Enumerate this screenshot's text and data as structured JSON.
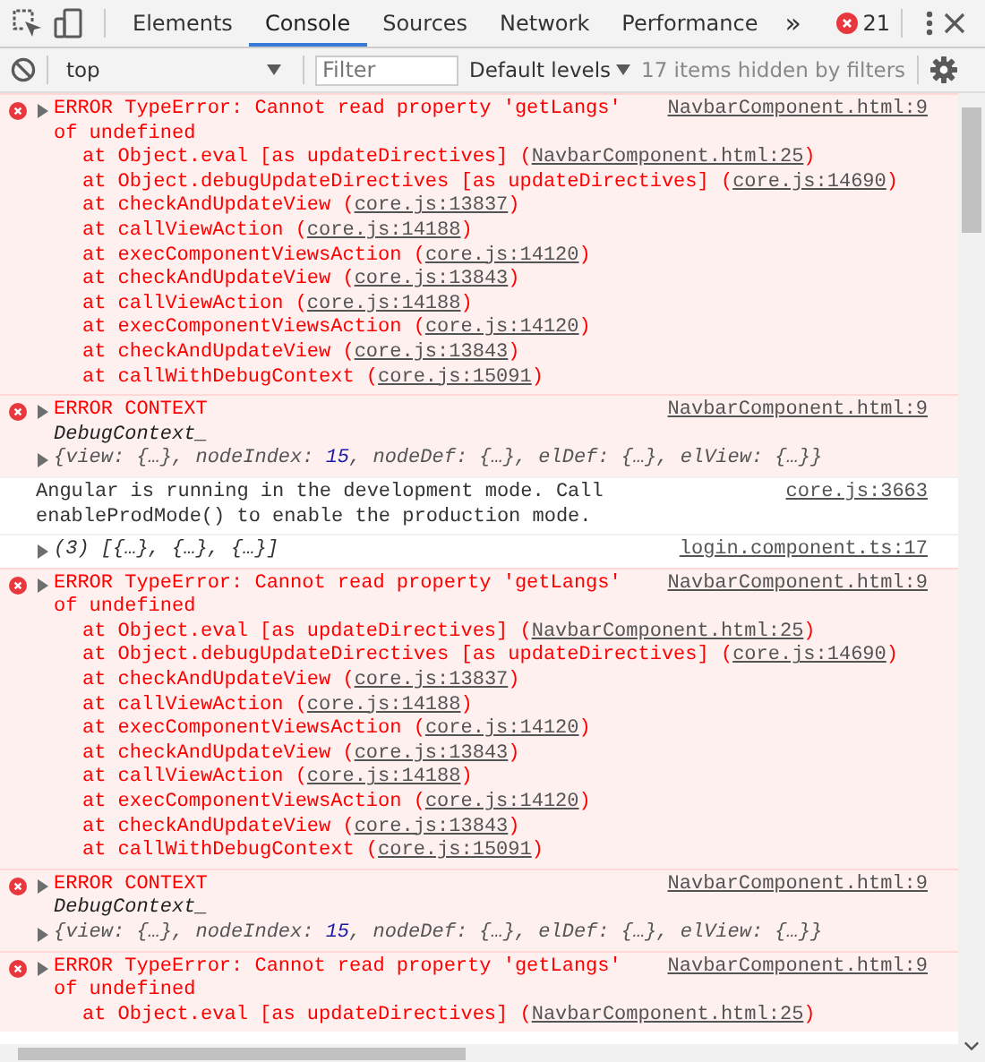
{
  "toolbar": {
    "tabs": [
      {
        "label": "Elements",
        "selected": false
      },
      {
        "label": "Console",
        "selected": true
      },
      {
        "label": "Sources",
        "selected": false
      },
      {
        "label": "Network",
        "selected": false
      },
      {
        "label": "Performance",
        "selected": false
      }
    ],
    "overflow": "»",
    "error_count": "21"
  },
  "console_bar": {
    "context": "top",
    "filter": {
      "placeholder": "Filter"
    },
    "levels": "Default levels",
    "hidden": "17 items hidden by filters"
  },
  "messages": [
    {
      "kind": "error",
      "expanded": false,
      "text": "ERROR TypeError: Cannot read property 'getLangs' of undefined",
      "source": "NavbarComponent.html:9",
      "stack": [
        {
          "call": "at Object.eval [as updateDirectives] (",
          "link": "NavbarComponent.html:25",
          "close": ")"
        },
        {
          "call": "at Object.debugUpdateDirectives [as updateDirectives] (",
          "link": "core.js:14690",
          "close": ")"
        },
        {
          "call": "at checkAndUpdateView (",
          "link": "core.js:13837",
          "close": ")"
        },
        {
          "call": "at callViewAction (",
          "link": "core.js:14188",
          "close": ")"
        },
        {
          "call": "at execComponentViewsAction (",
          "link": "core.js:14120",
          "close": ")"
        },
        {
          "call": "at checkAndUpdateView (",
          "link": "core.js:13843",
          "close": ")"
        },
        {
          "call": "at callViewAction (",
          "link": "core.js:14188",
          "close": ")"
        },
        {
          "call": "at execComponentViewsAction (",
          "link": "core.js:14120",
          "close": ")"
        },
        {
          "call": "at checkAndUpdateView (",
          "link": "core.js:13843",
          "close": ")"
        },
        {
          "call": "at callWithDebugContext (",
          "link": "core.js:15091",
          "close": ")"
        }
      ]
    },
    {
      "kind": "context",
      "expanded": false,
      "text": "ERROR CONTEXT",
      "source": "NavbarComponent.html:9",
      "object": {
        "name": "DebugContext_",
        "expanded": false,
        "preview": [
          {
            "kind": "plain",
            "text": "{view: {…}, nodeIndex: "
          },
          {
            "kind": "number",
            "text": "15"
          },
          {
            "kind": "plain",
            "text": ", nodeDef: {…}, elDef: {…}, elView: {…}}"
          }
        ]
      }
    },
    {
      "kind": "info",
      "text": "Angular is running in the development mode. Call enableProdMode() to enable the production mode.",
      "source": "core.js:3663"
    },
    {
      "kind": "log",
      "expanded": false,
      "text": "(3) [{…}, {…}, {…}]",
      "source": "login.component.ts:17"
    },
    {
      "kind": "error",
      "expanded": false,
      "text": "ERROR TypeError: Cannot read property 'getLangs' of undefined",
      "source": "NavbarComponent.html:9",
      "stack": [
        {
          "call": "at Object.eval [as updateDirectives] (",
          "link": "NavbarComponent.html:25",
          "close": ")"
        },
        {
          "call": "at Object.debugUpdateDirectives [as updateDirectives] (",
          "link": "core.js:14690",
          "close": ")"
        },
        {
          "call": "at checkAndUpdateView (",
          "link": "core.js:13837",
          "close": ")"
        },
        {
          "call": "at callViewAction (",
          "link": "core.js:14188",
          "close": ")"
        },
        {
          "call": "at execComponentViewsAction (",
          "link": "core.js:14120",
          "close": ")"
        },
        {
          "call": "at checkAndUpdateView (",
          "link": "core.js:13843",
          "close": ")"
        },
        {
          "call": "at callViewAction (",
          "link": "core.js:14188",
          "close": ")"
        },
        {
          "call": "at execComponentViewsAction (",
          "link": "core.js:14120",
          "close": ")"
        },
        {
          "call": "at checkAndUpdateView (",
          "link": "core.js:13843",
          "close": ")"
        },
        {
          "call": "at callWithDebugContext (",
          "link": "core.js:15091",
          "close": ")"
        }
      ]
    },
    {
      "kind": "context",
      "expanded": false,
      "text": "ERROR CONTEXT",
      "source": "NavbarComponent.html:9",
      "object": {
        "name": "DebugContext_",
        "expanded": false,
        "preview": [
          {
            "kind": "plain",
            "text": "{view: {…}, nodeIndex: "
          },
          {
            "kind": "number",
            "text": "15"
          },
          {
            "kind": "plain",
            "text": ", nodeDef: {…}, elDef: {…}, elView: {…}}"
          }
        ]
      }
    },
    {
      "kind": "error",
      "expanded": false,
      "text": "ERROR TypeError: Cannot read property 'getLangs' of undefined",
      "source": "NavbarComponent.html:9",
      "stack": [
        {
          "call": "at Object.eval [as updateDirectives] (",
          "link": "NavbarComponent.html:25",
          "close": ")"
        }
      ]
    }
  ]
}
